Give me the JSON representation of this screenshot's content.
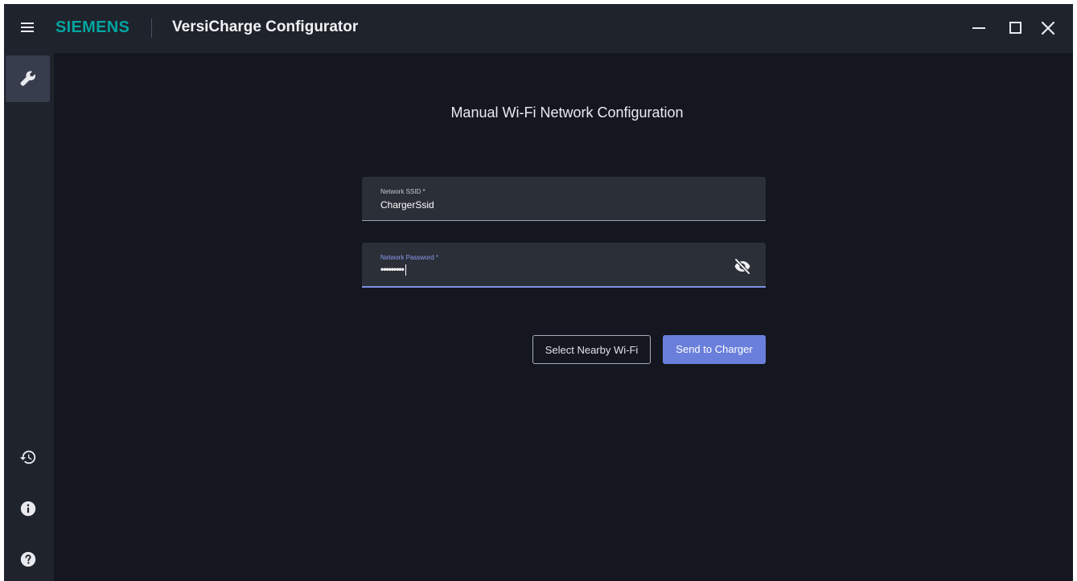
{
  "titlebar": {
    "brand": "SIEMENS",
    "app_title": "VersiCharge Configurator",
    "icons": {
      "menu": "hamburger-menu-icon",
      "minimize": "minimize-icon",
      "maximize": "maximize-icon",
      "close": "close-icon"
    }
  },
  "sidebar": {
    "top_items": [
      {
        "name": "configure",
        "icon": "wrench-icon",
        "active": true
      }
    ],
    "bottom_items": [
      {
        "name": "history",
        "icon": "history-icon"
      },
      {
        "name": "info",
        "icon": "info-icon"
      },
      {
        "name": "help",
        "icon": "help-icon"
      }
    ]
  },
  "main": {
    "heading": "Manual Wi-Fi Network Configuration",
    "ssid_field": {
      "label": "Network SSID *",
      "value": "ChargerSsid"
    },
    "password_field": {
      "label": "Network Password *",
      "masked_value": "•••••••••",
      "toggle_icon": "eye-off-icon",
      "focused": true
    },
    "buttons": {
      "select_wifi": "Select Nearby Wi-Fi",
      "send": "Send to Charger"
    }
  },
  "colors": {
    "window_bg": "#14171f",
    "chrome_bg": "#1f232c",
    "brand": "#00a5a0",
    "field_bg": "#2b2f38",
    "accent": "#6a7fdb",
    "focus_underline": "#7f90e6"
  }
}
